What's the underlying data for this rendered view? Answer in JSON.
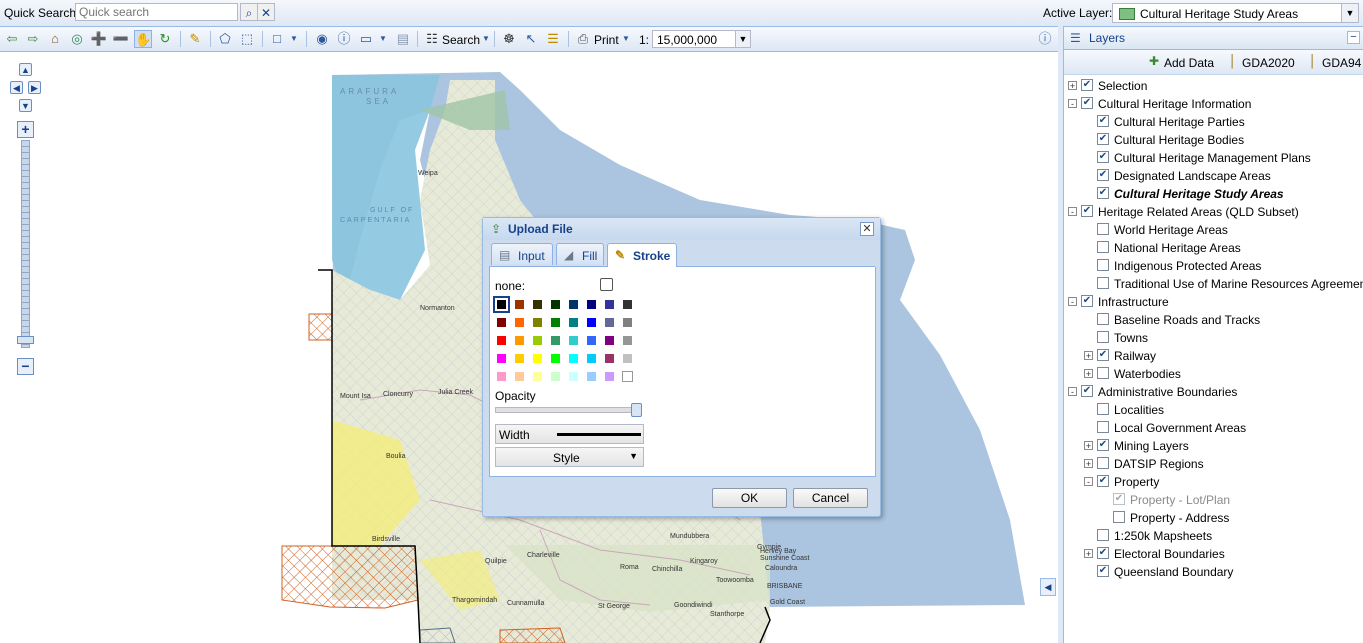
{
  "top_bar": {
    "quick_search_label": "Quick Search:",
    "quick_search_placeholder": "Quick search",
    "active_layer_label": "Active Layer:",
    "active_layer_value": "Cultural Heritage Study Areas"
  },
  "toolbar": {
    "search_label": "Search",
    "print_label": "Print",
    "scale_prefix": "1:",
    "scale_value": "15,000,000"
  },
  "map_labels": {
    "arafura_sea": "ARAFURA SEA",
    "gulf_of_carpentaria": "GULF OF CARPENTARIA",
    "places": [
      "Weipa",
      "Normanton",
      "Mount Isa",
      "Cloncurry",
      "Julia Creek",
      "Boulia",
      "Birdsville",
      "Charleville",
      "Quilpie",
      "Cunnamulla",
      "Thargomindah",
      "Roma",
      "Toowoomba",
      "Chinchilla",
      "Kingaroy",
      "St George",
      "Goondiwindi",
      "Stanthorpe",
      "Hervey Bay",
      "Gympie",
      "Sunshine Coast",
      "Caloundra",
      "BRISBANE",
      "Gold Coast",
      "Mundubbera"
    ]
  },
  "layers_panel": {
    "title": "Layers",
    "tools": {
      "add_data": "Add Data",
      "gda2020": "GDA2020",
      "gda94": "GDA94"
    },
    "tree": [
      {
        "label": "Selection",
        "level": 0,
        "expander": "+",
        "checked": true
      },
      {
        "label": "Cultural Heritage Information",
        "level": 0,
        "expander": "-",
        "checked": true
      },
      {
        "label": "Cultural Heritage Parties",
        "level": 1,
        "checked": true
      },
      {
        "label": "Cultural Heritage Bodies",
        "level": 1,
        "checked": true
      },
      {
        "label": "Cultural Heritage Management Plans",
        "level": 1,
        "checked": true
      },
      {
        "label": "Designated Landscape Areas",
        "level": 1,
        "checked": true
      },
      {
        "label": "Cultural Heritage Study Areas",
        "level": 1,
        "checked": true,
        "active": true
      },
      {
        "label": "Heritage Related Areas (QLD Subset)",
        "level": 0,
        "expander": "-",
        "checked": true
      },
      {
        "label": "World Heritage Areas",
        "level": 1,
        "checked": false
      },
      {
        "label": "National Heritage Areas",
        "level": 1,
        "checked": false
      },
      {
        "label": "Indigenous Protected Areas",
        "level": 1,
        "checked": false
      },
      {
        "label": "Traditional Use of Marine Resources Agreement",
        "level": 1,
        "checked": false
      },
      {
        "label": "Infrastructure",
        "level": 0,
        "expander": "-",
        "checked": true
      },
      {
        "label": "Baseline Roads and Tracks",
        "level": 1,
        "checked": false
      },
      {
        "label": "Towns",
        "level": 1,
        "checked": false
      },
      {
        "label": "Railway",
        "level": 1,
        "expander": "+",
        "checked": true
      },
      {
        "label": "Waterbodies",
        "level": 1,
        "expander": "+",
        "checked": false
      },
      {
        "label": "Administrative Boundaries",
        "level": 0,
        "expander": "-",
        "checked": true
      },
      {
        "label": "Localities",
        "level": 1,
        "checked": false
      },
      {
        "label": "Local Government Areas",
        "level": 1,
        "checked": false
      },
      {
        "label": "Mining Layers",
        "level": 1,
        "expander": "+",
        "checked": true
      },
      {
        "label": "DATSIP Regions",
        "level": 1,
        "expander": "+",
        "checked": false
      },
      {
        "label": "Property",
        "level": 1,
        "expander": "-",
        "checked": true
      },
      {
        "label": "Property - Lot/Plan",
        "level": 2,
        "checked": true,
        "disabled": true
      },
      {
        "label": "Property - Address",
        "level": 2,
        "checked": false
      },
      {
        "label": "1:250k Mapsheets",
        "level": 1,
        "checked": false
      },
      {
        "label": "Electoral Boundaries",
        "level": 1,
        "expander": "+",
        "checked": true
      },
      {
        "label": "Queensland Boundary",
        "level": 1,
        "checked": true
      }
    ]
  },
  "dialog": {
    "title": "Upload File",
    "tabs": [
      "Input",
      "Fill",
      "Stroke"
    ],
    "active_tab": "Stroke",
    "none_label": "none:",
    "opacity_label": "Opacity",
    "opacity_value": 1.0,
    "width_label": "Width",
    "style_label": "Style",
    "ok_label": "OK",
    "cancel_label": "Cancel",
    "selected_color": "#000000",
    "palette": [
      [
        "#000000",
        "#993300",
        "#333300",
        "#003300",
        "#003366",
        "#000080",
        "#333399",
        "#333333"
      ],
      [
        "#800000",
        "#FF6600",
        "#808000",
        "#008000",
        "#008080",
        "#0000FF",
        "#666699",
        "#808080"
      ],
      [
        "#FF0000",
        "#FF9900",
        "#99CC00",
        "#339966",
        "#33CCCC",
        "#3366FF",
        "#800080",
        "#969696"
      ],
      [
        "#FF00FF",
        "#FFCC00",
        "#FFFF00",
        "#00FF00",
        "#00FFFF",
        "#00CCFF",
        "#993366",
        "#C0C0C0"
      ],
      [
        "#FF99CC",
        "#FFCC99",
        "#FFFF99",
        "#CCFFCC",
        "#CCFFFF",
        "#99CCFF",
        "#CC99FF",
        "#FFFFFF"
      ]
    ]
  }
}
